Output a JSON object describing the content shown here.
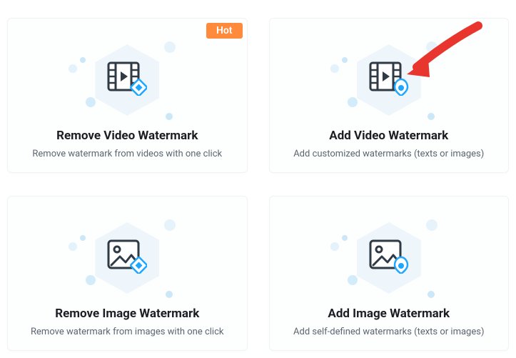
{
  "badge": {
    "hot": "Hot"
  },
  "cards": [
    {
      "title": "Remove Video Watermark",
      "desc": "Remove watermark from videos with one click",
      "icon": "video-remove-icon",
      "hot": true
    },
    {
      "title": "Add Video Watermark",
      "desc": "Add customized watermarks (texts or images)",
      "icon": "video-add-icon",
      "hot": false
    },
    {
      "title": "Remove Image Watermark",
      "desc": "Remove watermark from images with one click",
      "icon": "image-remove-icon",
      "hot": false
    },
    {
      "title": "Add Image Watermark",
      "desc": "Add self-defined watermarks  (texts or images)",
      "icon": "image-add-icon",
      "hot": false
    }
  ]
}
